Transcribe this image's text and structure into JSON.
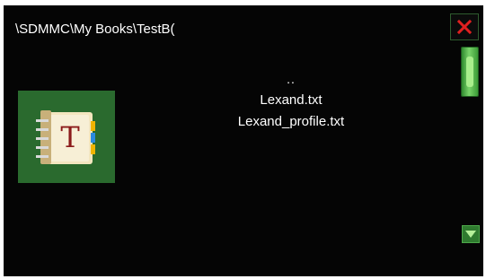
{
  "header": {
    "path": "\\SDMMC\\My Books\\TestB("
  },
  "toolbar": {
    "close_icon": "close-icon",
    "close_color": "#e02020"
  },
  "file_list": {
    "items": [
      {
        "label": "..",
        "type": "parent-directory"
      },
      {
        "label": "Lexand.txt",
        "type": "file"
      },
      {
        "label": "Lexand_profile.txt",
        "type": "file"
      }
    ]
  },
  "book_tile": {
    "icon": "book-icon",
    "letter": "T",
    "background": "#2a6a2e"
  },
  "scrollbar": {
    "position": 0,
    "down_icon": "arrow-down-icon"
  }
}
